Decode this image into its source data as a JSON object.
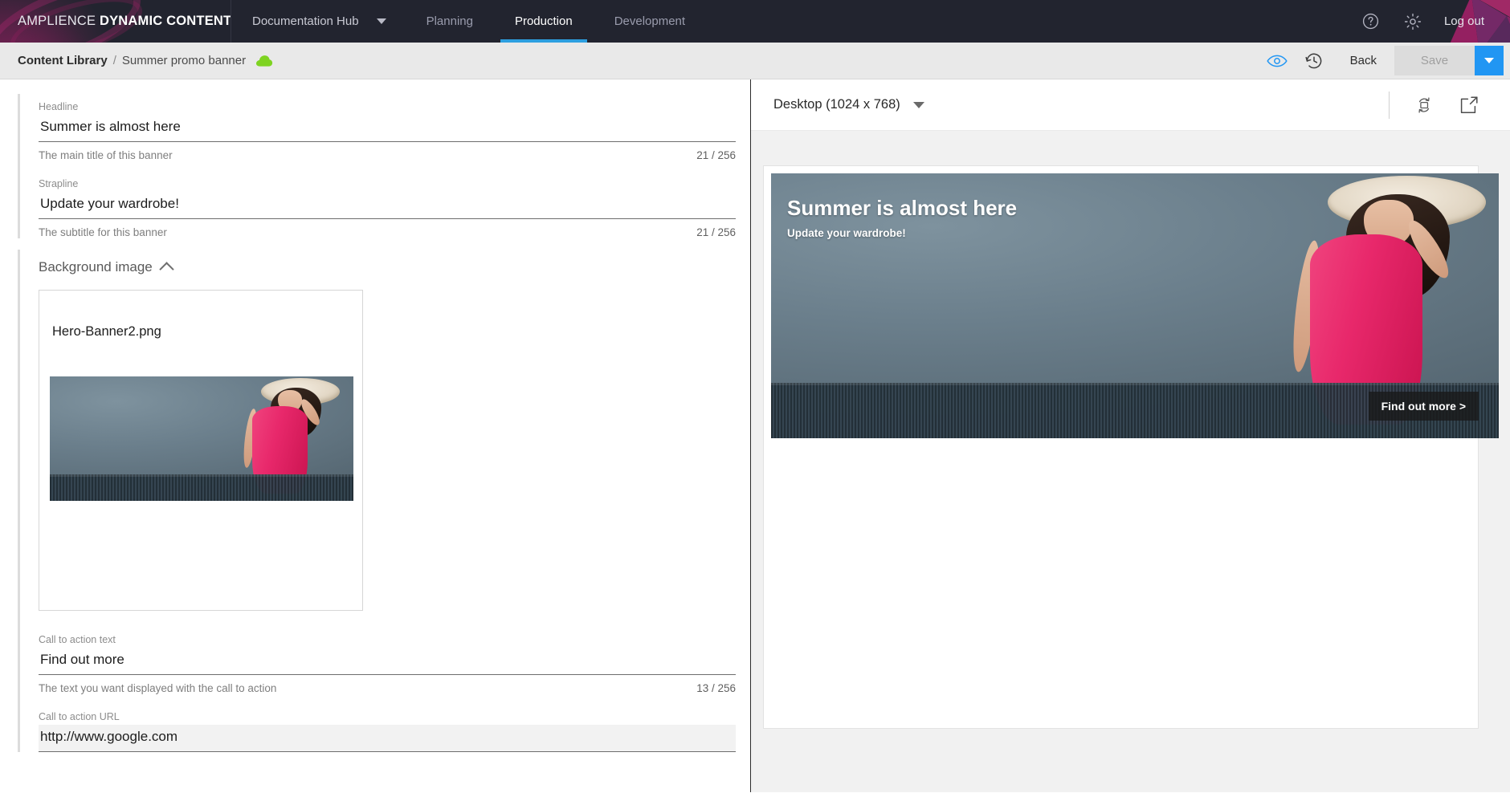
{
  "topnav": {
    "brand_thin": "AMPLIENCE",
    "brand_bold": "DYNAMIC CONTENT",
    "hub_label": "Documentation Hub",
    "items": [
      {
        "label": "Planning",
        "active": false
      },
      {
        "label": "Production",
        "active": true
      },
      {
        "label": "Development",
        "active": false
      }
    ],
    "help_icon": "help-circle-icon",
    "settings_icon": "gear-icon",
    "logout_label": "Log out",
    "accent_color": "#2d9fe0",
    "background_color": "#22242f"
  },
  "breadcrumb": {
    "root": "Content Library",
    "separator": "/",
    "leaf": "Summer promo banner",
    "status_icon": "green-cloud-icon",
    "status_color": "#7ed321",
    "preview_icon": "eye-icon",
    "history_icon": "history-clock-icon",
    "back_label": "Back",
    "save_label": "Save",
    "save_enabled": false,
    "save_dropdown_icon": "chevron-down-icon",
    "save_dropdown_color": "#2196f3"
  },
  "form": {
    "fields": [
      {
        "label": "Headline",
        "value": "Summer is almost here",
        "help": "The main title of this banner",
        "count": "21 / 256",
        "focused": false
      },
      {
        "label": "Strapline",
        "value": "Update your wardrobe!",
        "help": "The subtitle for this banner",
        "count": "21 / 256",
        "focused": false
      }
    ],
    "image_section": {
      "title": "Background image",
      "collapse_icon": "chevron-up-icon",
      "card": {
        "filename": "Hero-Banner2.png"
      }
    },
    "fields2": [
      {
        "label": "Call to action text",
        "value": "Find out more",
        "help": "The text you want displayed with the call to action",
        "count": "13 / 256",
        "focused": false
      },
      {
        "label": "Call to action URL",
        "value": "http://www.google.com",
        "help": "",
        "count": "",
        "focused": true
      }
    ]
  },
  "preview": {
    "device": "Desktop (1024 x 768)",
    "device_caret_icon": "chevron-down-icon",
    "rotate_icon": "rotate-device-icon",
    "open_external_icon": "open-in-new-icon",
    "banner": {
      "headline": "Summer is almost here",
      "strapline": "Update your wardrobe!",
      "cta": "Find out more >"
    }
  }
}
